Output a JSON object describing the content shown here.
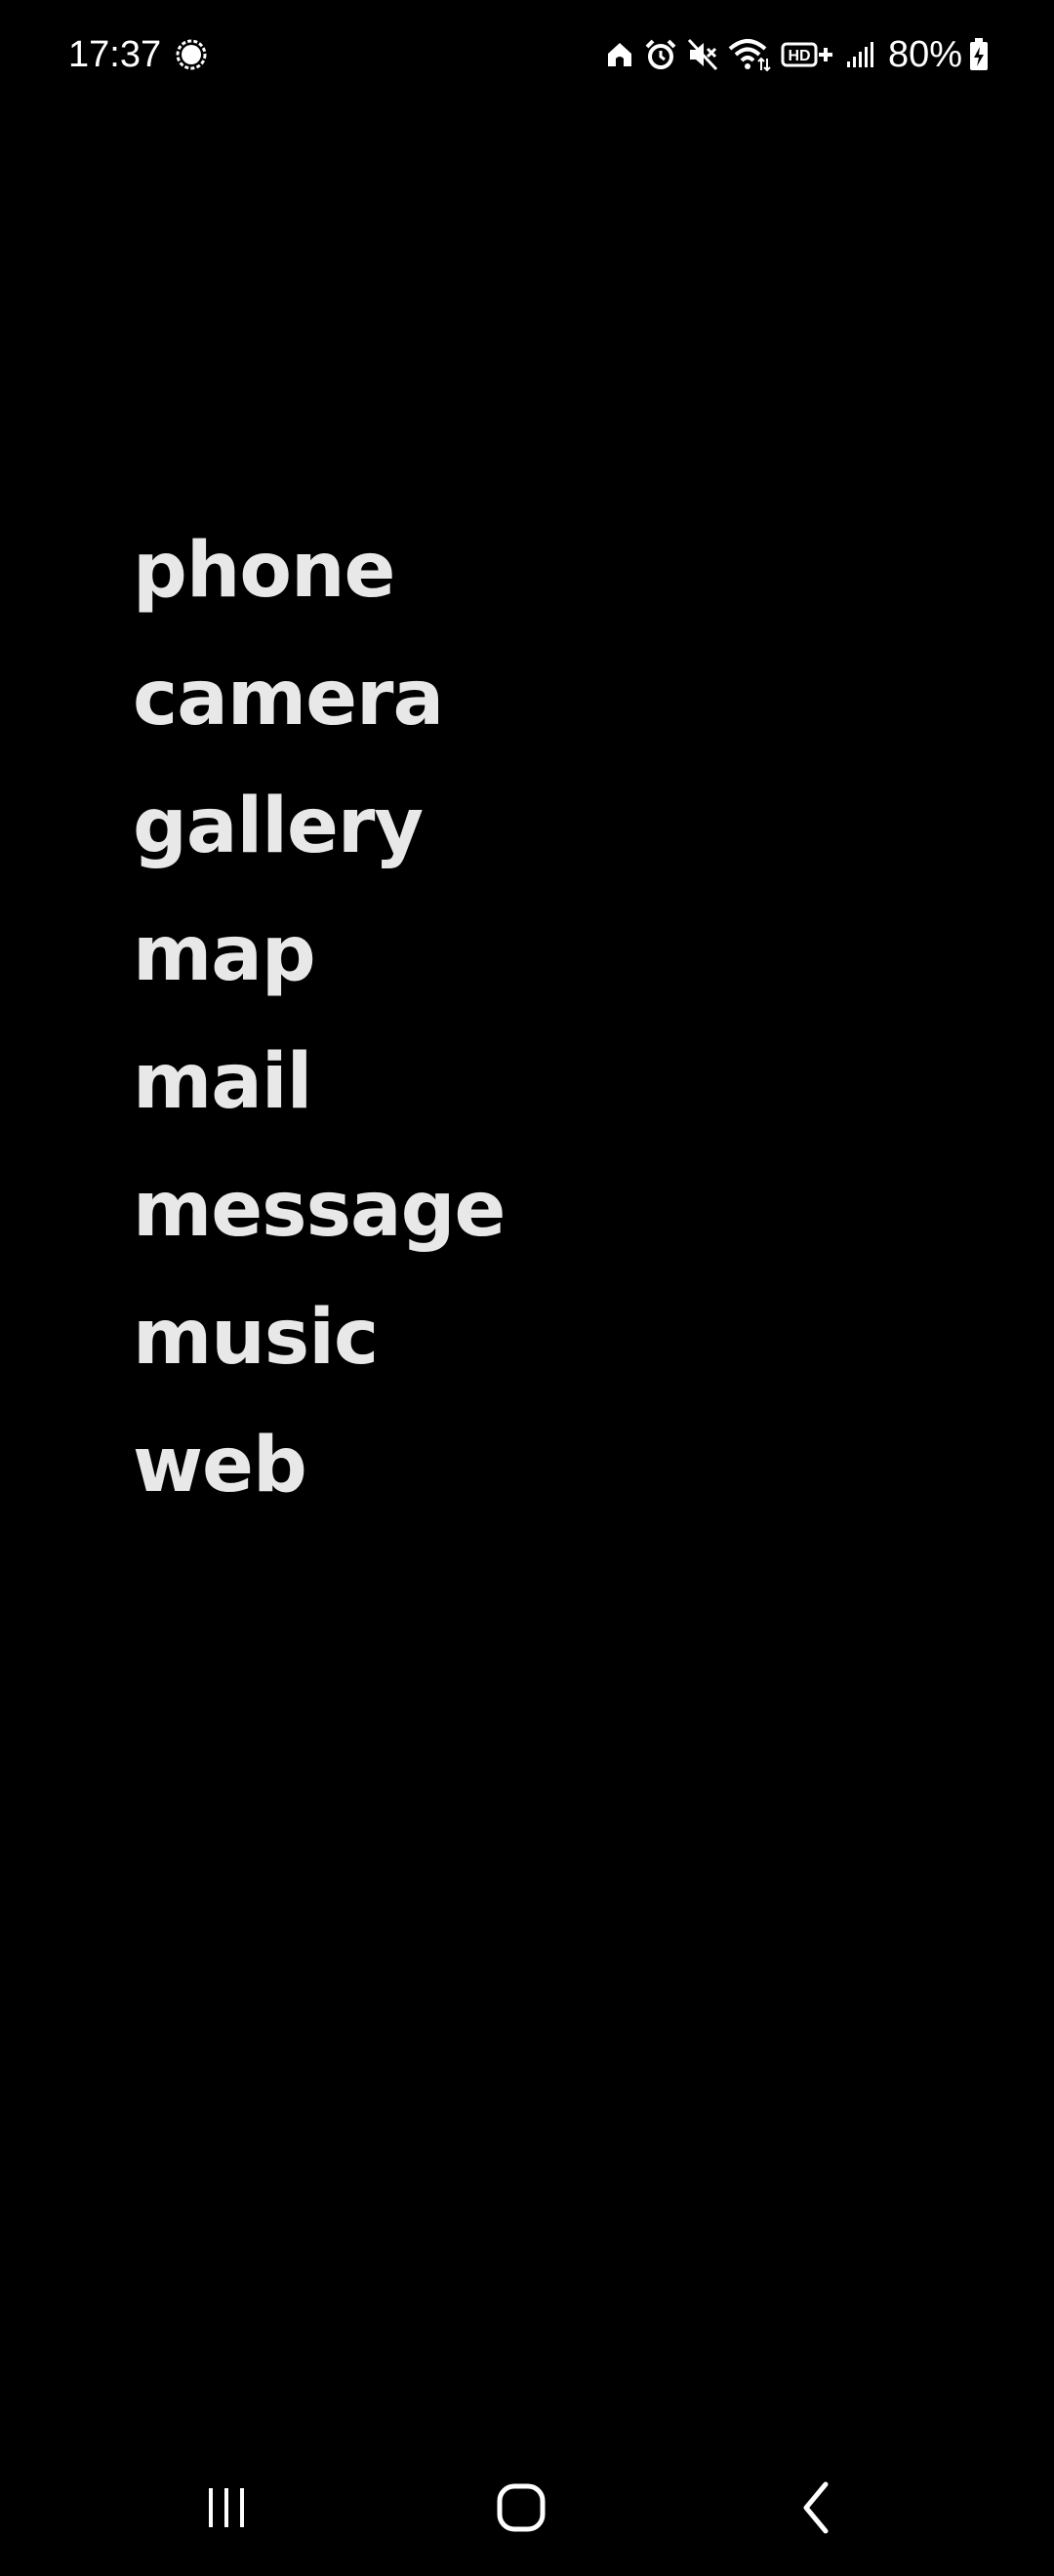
{
  "status_bar": {
    "time": "17:37",
    "notification_icon": "chat-bubble-icon",
    "icons": [
      "home-icon",
      "alarm-icon",
      "mute-icon",
      "wifi-icon",
      "hd-plus-icon",
      "signal-icon"
    ],
    "battery_percent": "80%",
    "battery_state": "charging"
  },
  "menu": {
    "items": [
      {
        "label": "phone"
      },
      {
        "label": "camera"
      },
      {
        "label": "gallery"
      },
      {
        "label": "map"
      },
      {
        "label": "mail"
      },
      {
        "label": "message"
      },
      {
        "label": "music"
      },
      {
        "label": "web"
      }
    ]
  },
  "nav_bar": {
    "buttons": [
      "recents-icon",
      "home-icon",
      "back-icon"
    ]
  },
  "colors": {
    "background": "#000000",
    "menu_text": "#e8e8e8",
    "status_text": "#ffffff"
  }
}
